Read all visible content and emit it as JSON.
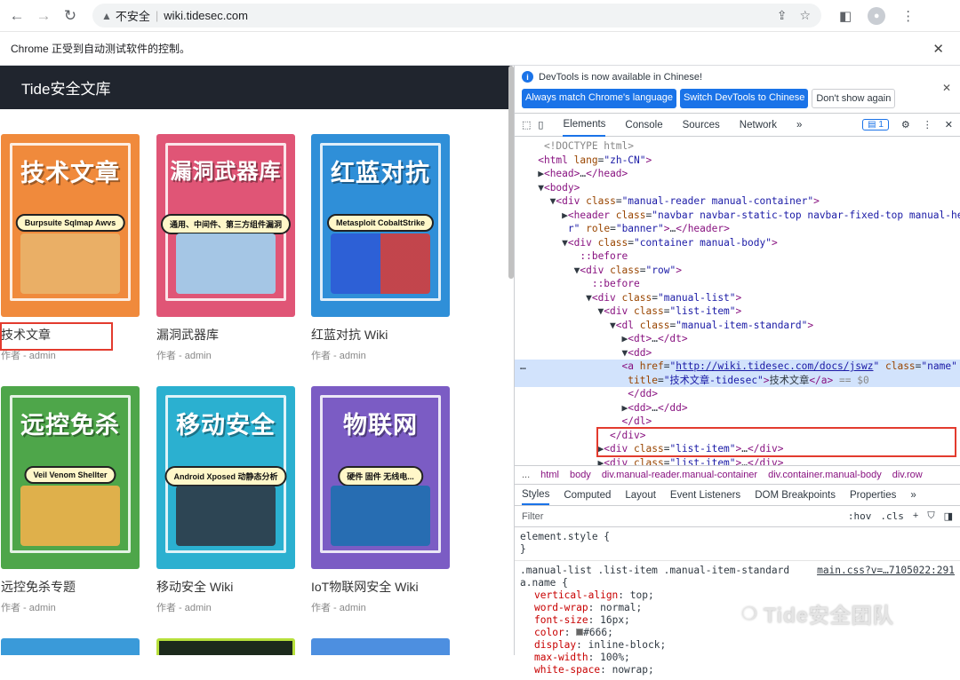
{
  "browser": {
    "insecure_label": "不安全",
    "url": "wiki.tidesec.com",
    "automation_notice": "Chrome 正受到自动测试软件的控制。"
  },
  "site": {
    "brand": "Tide安全文库",
    "cards": [
      {
        "cover_title": "技术文章",
        "cover_tag": "Burpsuite Sqlmap Awvs",
        "name": "技术文章",
        "author": "作者 - admin",
        "color": "#f08a3c"
      },
      {
        "cover_title": "漏洞武器库",
        "cover_tag": "通用、中间件、第三方组件漏洞",
        "name": "漏洞武器库",
        "author": "作者 - admin",
        "color": "#e05576"
      },
      {
        "cover_title": "红蓝对抗",
        "cover_tag": "Metasploit CobaltStrike",
        "name": "红蓝对抗 Wiki",
        "author": "作者 - admin",
        "color": "#2f8fd8"
      },
      {
        "cover_title": "远控免杀",
        "cover_tag": "Veil Venom Shellter",
        "name": "远控免杀专题",
        "author": "作者 - admin",
        "color": "#4ea64a"
      },
      {
        "cover_title": "移动安全",
        "cover_tag": "Android Xposed 动静态分析",
        "name": "移动安全 Wiki",
        "author": "作者 - admin",
        "color": "#2bb0d0"
      },
      {
        "cover_title": "物联网",
        "cover_tag": "硬件 固件 无线电...",
        "name": "IoT物联网安全 Wiki",
        "author": "作者 - admin",
        "color": "#7b5cc4"
      }
    ]
  },
  "devtools": {
    "info_message": "DevTools is now available in Chinese!",
    "btn_match": "Always match Chrome's language",
    "btn_switch": "Switch DevTools to Chinese",
    "btn_dont": "Don't show again",
    "tabs": [
      "Elements",
      "Console",
      "Sources",
      "Network"
    ],
    "issues_count": "1",
    "breadcrumb": [
      "...",
      "html",
      "body",
      "div.manual-reader.manual-container",
      "div.container.manual-body",
      "div.row"
    ],
    "style_tabs": [
      "Styles",
      "Computed",
      "Layout",
      "Event Listeners",
      "DOM Breakpoints",
      "Properties"
    ],
    "filter_placeholder": "Filter",
    "filter_hov": ":hov",
    "filter_cls": ".cls",
    "element_style": "element.style {",
    "rule_selector_1": ".manual-list .list-item .manual-item-standard",
    "rule_selector_2": "a.name {",
    "rule_source": "main.css?v=…7105022:291",
    "props": [
      {
        "name": "vertical-align",
        "value": "top;"
      },
      {
        "name": "word-wrap",
        "value": "normal;"
      },
      {
        "name": "font-size",
        "value": "16px;"
      },
      {
        "name": "color",
        "value": "#666;"
      },
      {
        "name": "display",
        "value": "inline-block;"
      },
      {
        "name": "max-width",
        "value": "100%;"
      },
      {
        "name": "white-space",
        "value": "nowrap;"
      }
    ]
  },
  "watermark": "Tide安全团队"
}
